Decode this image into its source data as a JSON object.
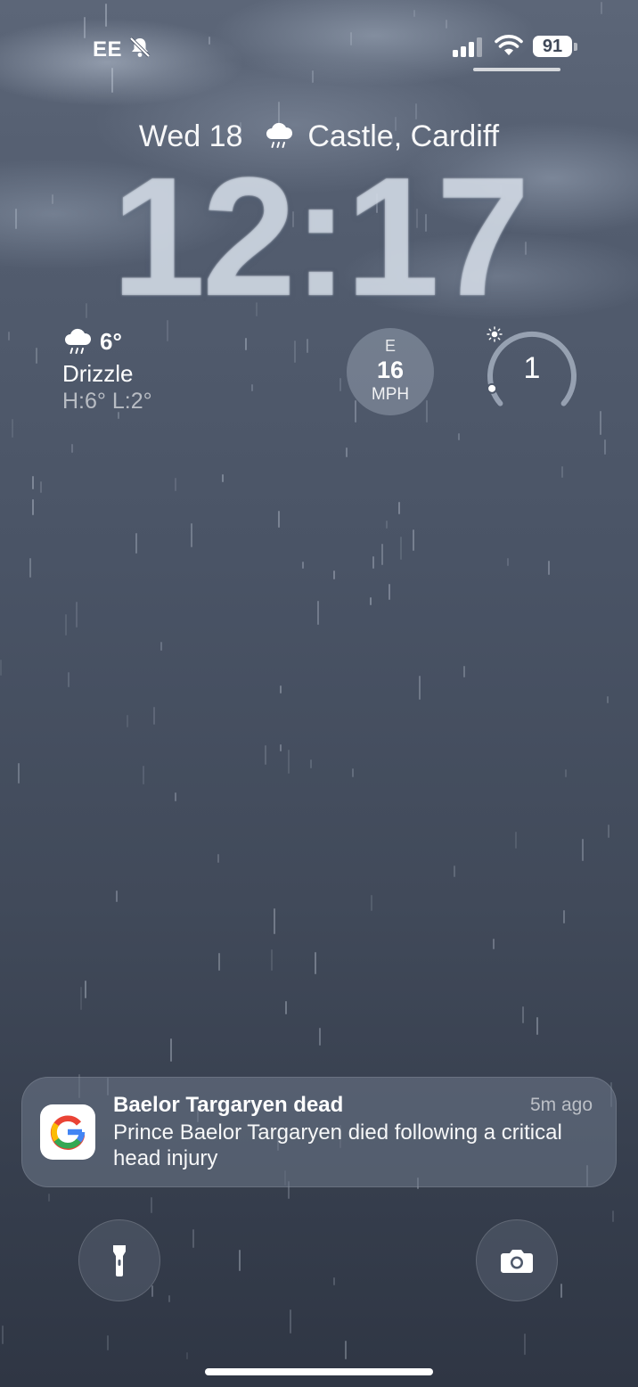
{
  "status_bar": {
    "carrier": "EE",
    "silent_icon": "bell-slash-icon",
    "signal_icon": "cellular-signal-icon",
    "wifi_icon": "wifi-icon",
    "battery_level": "91"
  },
  "lock_screen": {
    "date": "Wed 18",
    "weather_icon": "cloud-drizzle-icon",
    "location": "Castle, Cardiff",
    "time": "12:17"
  },
  "widgets": {
    "weather": {
      "icon": "cloud-drizzle-icon",
      "temperature": "6°",
      "condition": "Drizzle",
      "high_low": "H:6° L:2°"
    },
    "wind": {
      "direction": "E",
      "speed": "16",
      "unit": "MPH"
    },
    "uv_index": {
      "value": "1",
      "icon": "sun-icon",
      "level_fraction": 0.09
    }
  },
  "notification": {
    "app_icon": "google-icon",
    "title": "Baelor Targaryen dead",
    "time": "5m ago",
    "body": "Prince Baelor Targaryen died following a critical head injury"
  },
  "quick_actions": {
    "flashlight_icon": "flashlight-icon",
    "camera_icon": "camera-icon"
  },
  "colors": {
    "background_top": "#5c6678",
    "background_bottom": "#2f3644",
    "google_blue": "#4285F4",
    "google_red": "#EA4335",
    "google_yellow": "#FBBC05",
    "google_green": "#34A853"
  }
}
